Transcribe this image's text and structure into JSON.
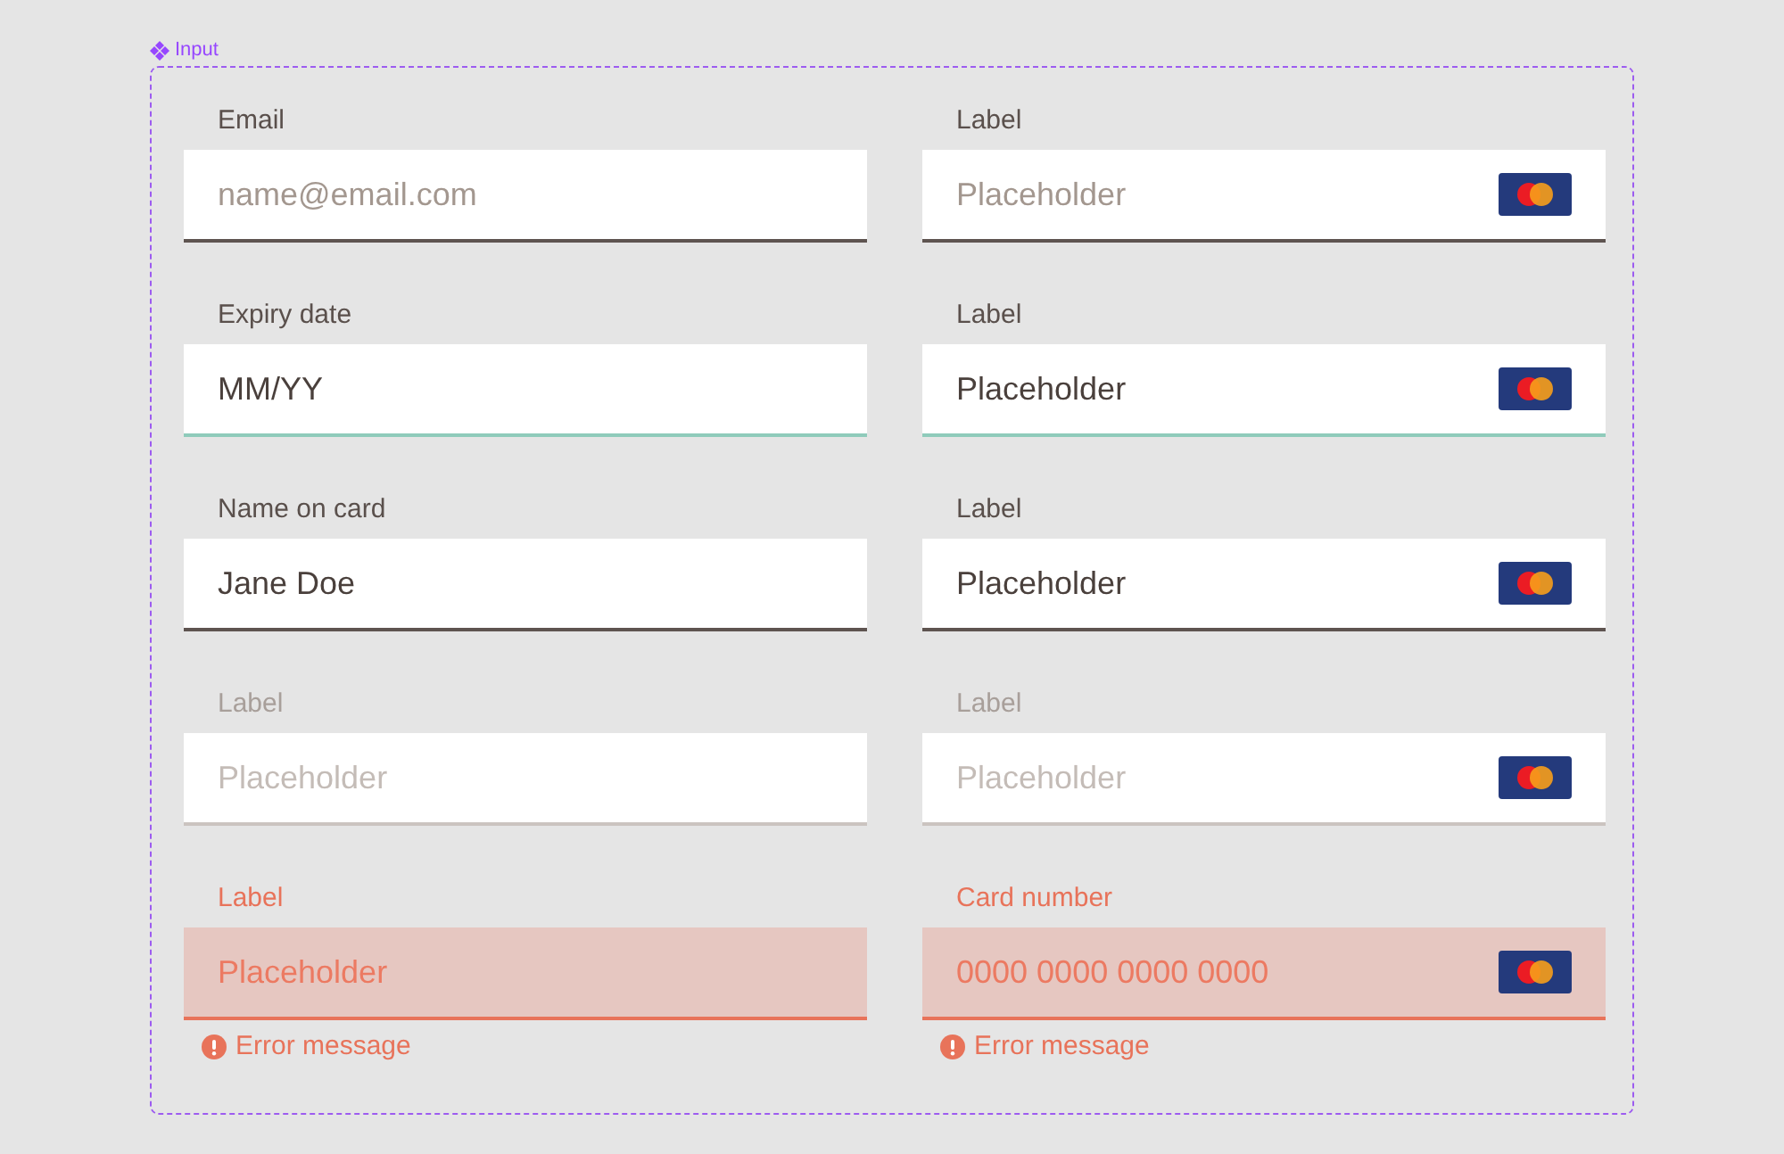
{
  "component": {
    "name": "Input"
  },
  "fields": [
    {
      "label": "Email",
      "placeholder": "name@email.com",
      "card_icon": false,
      "focused": false,
      "disabled": false,
      "error": false
    },
    {
      "label": "Label",
      "placeholder": "Placeholder",
      "card_icon": true,
      "focused": false,
      "disabled": false,
      "error": false
    },
    {
      "label": "Expiry date",
      "value": "MM/YY",
      "card_icon": false,
      "focused": true,
      "disabled": false,
      "error": false
    },
    {
      "label": "Label",
      "value": "Placeholder",
      "card_icon": true,
      "focused": true,
      "disabled": false,
      "error": false
    },
    {
      "label": "Name on card",
      "value": "Jane Doe",
      "card_icon": false,
      "focused": false,
      "disabled": false,
      "error": false
    },
    {
      "label": "Label",
      "value": "Placeholder",
      "card_icon": true,
      "focused": false,
      "disabled": false,
      "error": false
    },
    {
      "label": "Label",
      "placeholder": "Placeholder",
      "card_icon": false,
      "focused": false,
      "disabled": true,
      "error": false
    },
    {
      "label": "Label",
      "placeholder": "Placeholder",
      "card_icon": true,
      "focused": false,
      "disabled": true,
      "error": false
    },
    {
      "label": "Label",
      "placeholder": "Placeholder",
      "card_icon": false,
      "focused": false,
      "disabled": false,
      "error": true,
      "error_message": "Error message"
    },
    {
      "label": "Card number",
      "placeholder": "0000 0000 0000 0000",
      "card_icon": true,
      "focused": false,
      "disabled": false,
      "error": true,
      "error_message": "Error message"
    }
  ]
}
